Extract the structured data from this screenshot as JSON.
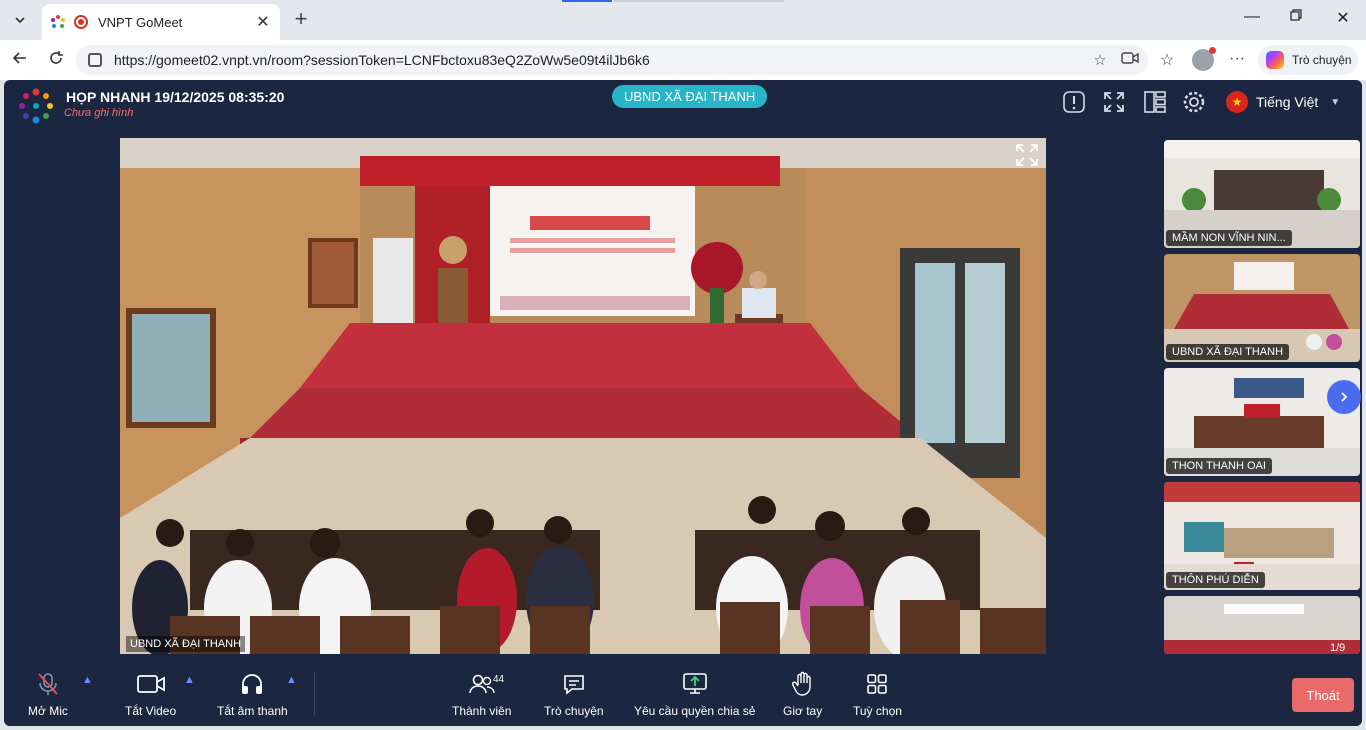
{
  "browser": {
    "tab_title": "VNPT GoMeet",
    "url": "https://gomeet02.vnpt.vn/room?sessionToken=LCNFbctoxu83eQ2ZoWw5e09t4ilJb6k6",
    "copilot_label": "Trò chuyện"
  },
  "header": {
    "meeting_title": "HỌP NHANH 19/12/2025 08:35:20",
    "recording_status": "Chưa ghi hình",
    "room_badge": "UBND XÃ ĐẠI THANH",
    "language": "Tiếng Việt"
  },
  "main_video": {
    "label": "UBND XÃ ĐẠI THANH"
  },
  "thumbnails": [
    {
      "label": "MẦM NON VĨNH NIN..."
    },
    {
      "label": "UBND XÃ ĐẠI THANH"
    },
    {
      "label": "THON THANH OAI"
    },
    {
      "label": "THÔN PHÚ DIỄN"
    },
    {
      "label": ""
    }
  ],
  "pagination": "1/9",
  "toolbar": {
    "mic": "Mở Mic",
    "video": "Tắt Video",
    "audio": "Tắt âm thanh",
    "members": "Thành viên",
    "members_count": "44",
    "chat": "Trò chuyện",
    "share_request": "Yêu cầu quyền chia sẻ",
    "raise_hand": "Giơ tay",
    "options": "Tuỳ chọn",
    "leave": "Thoát"
  },
  "colors": {
    "app_bg": "#1b2640",
    "badge": "#27b5c7",
    "leave": "#e96a6a",
    "next": "#4a6cf0"
  }
}
